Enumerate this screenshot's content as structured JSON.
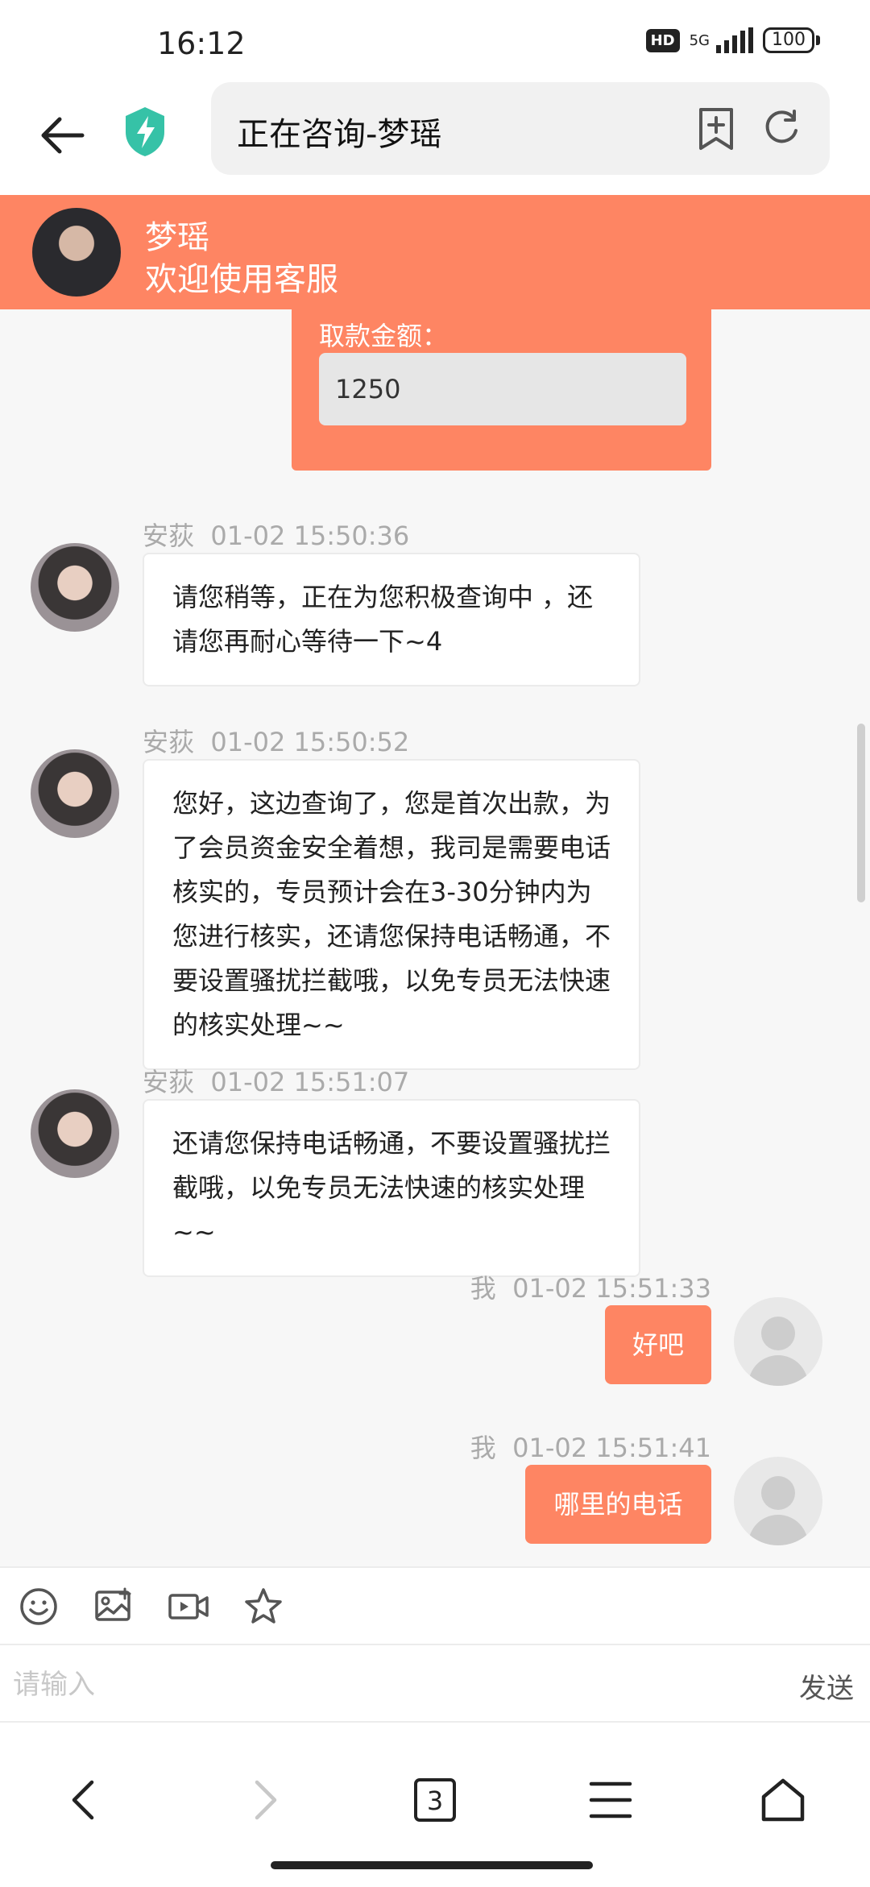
{
  "status_bar": {
    "time": "16:12",
    "hd": "HD",
    "network": "5G",
    "battery": "100"
  },
  "nav": {
    "title": "正在咨询-梦瑶"
  },
  "chat_header": {
    "name": "梦瑶",
    "welcome": "欢迎使用客服"
  },
  "card": {
    "label": "取款金额：",
    "value": "1250"
  },
  "messages": [
    {
      "sender": "安荻",
      "time": "01-02 15:50:36",
      "text": "请您稍等，正在为您积极查询中 ，还请您再耐心等待一下~4"
    },
    {
      "sender": "安荻",
      "time": "01-02 15:50:52",
      "text": "您好，这边查询了，您是首次出款，为了会员资金安全着想，我司是需要电话核实的，专员预计会在3-30分钟内为您进行核实，还请您保持电话畅通，不要设置骚扰拦截哦，以免专员无法快速的核实处理~~"
    },
    {
      "sender": "安荻",
      "time": "01-02 15:51:07",
      "text": "还请您保持电话畅通，不要设置骚扰拦截哦，以免专员无法快速的核实处理~~"
    },
    {
      "sender": "我",
      "time": "01-02 15:51:33",
      "text": "好吧"
    },
    {
      "sender": "我",
      "time": "01-02 15:51:41",
      "text": "哪里的电话"
    }
  ],
  "input": {
    "placeholder": "请输入",
    "send_label": "发送"
  },
  "bottom_nav": {
    "tabs_count": "3"
  },
  "colors": {
    "accent": "#fe8563"
  }
}
